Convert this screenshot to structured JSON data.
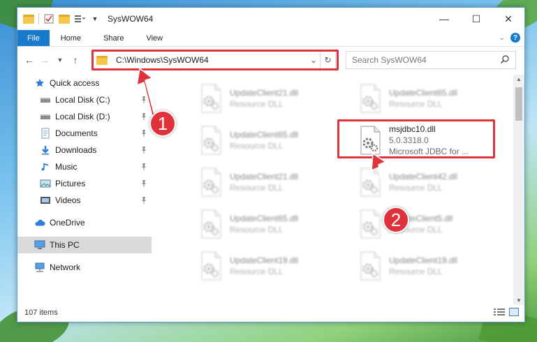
{
  "window": {
    "title": "SysWOW64",
    "controls": {
      "minimize": "—",
      "maximize": "☐",
      "close": "✕"
    }
  },
  "ribbon": {
    "tabs": [
      {
        "label": "File"
      },
      {
        "label": "Home"
      },
      {
        "label": "Share"
      },
      {
        "label": "View"
      }
    ],
    "help": "?"
  },
  "nav": {
    "address_path": "C:\\Windows\\SysWOW64",
    "search_placeholder": "Search SysWOW64"
  },
  "sidebar": {
    "items": [
      {
        "label": "Quick access",
        "icon": "star-icon"
      },
      {
        "label": "Local Disk (C:)",
        "icon": "drive-icon",
        "pinned": true
      },
      {
        "label": "Local Disk (D:)",
        "icon": "drive-icon",
        "pinned": true
      },
      {
        "label": "Documents",
        "icon": "documents-icon",
        "pinned": true
      },
      {
        "label": "Downloads",
        "icon": "download-icon",
        "pinned": true
      },
      {
        "label": "Music",
        "icon": "music-icon",
        "pinned": true
      },
      {
        "label": "Pictures",
        "icon": "pictures-icon",
        "pinned": true
      },
      {
        "label": "Videos",
        "icon": "videos-icon",
        "pinned": true
      },
      {
        "label": "OneDrive",
        "icon": "cloud-icon"
      },
      {
        "label": "This PC",
        "icon": "computer-icon",
        "selected": true
      },
      {
        "label": "Network",
        "icon": "network-icon"
      }
    ]
  },
  "files": [
    {
      "name": "UpdateClient21.dll",
      "type": "Resource DLL"
    },
    {
      "name": "UpdateClient65.dll",
      "type": "Resource DLL"
    },
    {
      "name": "UpdateClient65.dll",
      "type": "Resource DLL"
    },
    {
      "name": "msjdbc10.dll",
      "version": "5.0.3318.0",
      "description": "Microsoft JDBC for ...",
      "highlighted": true
    },
    {
      "name": "UpdateClient21.dll",
      "type": "Resource DLL"
    },
    {
      "name": "UpdateClient42.dll",
      "type": "Resource DLL"
    },
    {
      "name": "UpdateClient65.dll",
      "type": "Resource DLL"
    },
    {
      "name": "UpdateClient5.dll",
      "type": "Resource DLL"
    },
    {
      "name": "UpdateClient19.dll",
      "type": "Resource DLL"
    },
    {
      "name": "UpdateClient19.dll",
      "type": "Resource DLL"
    }
  ],
  "status": {
    "item_count": "107 items"
  },
  "annotations": {
    "step1": "1",
    "step2": "2",
    "color": "#e0323a"
  }
}
